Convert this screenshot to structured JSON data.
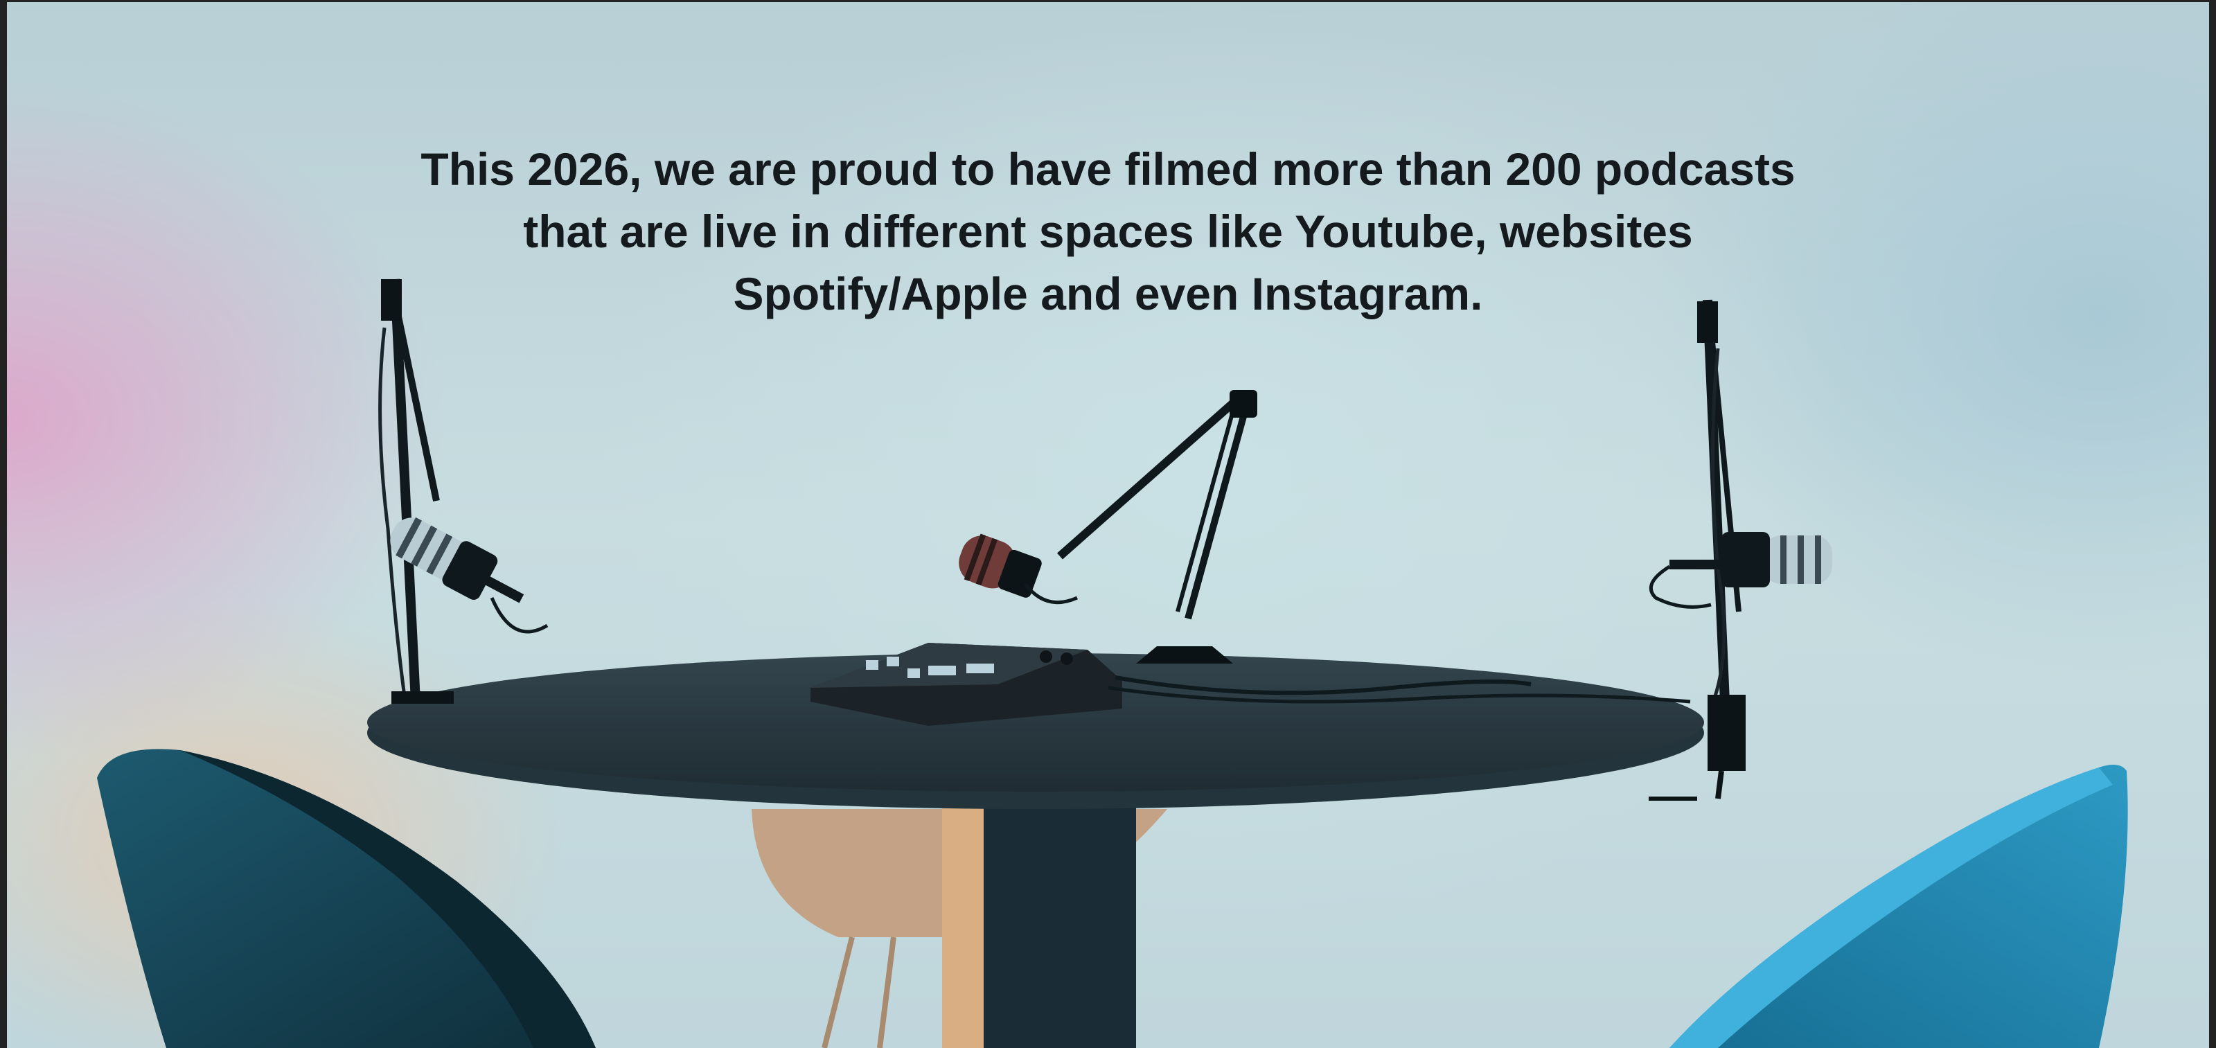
{
  "headline": {
    "lines": [
      "This 2026, we are proud to have filmed more than 200 podcasts",
      "that are live in different spaces like Youtube, websites",
      "Spotify/Apple and even Instagram."
    ]
  },
  "photo": {
    "subject": "podcast studio table with three microphones on boom arms, audio mixer and chairs",
    "colors": {
      "table": "#2b3a42",
      "chair": "#1f6f8f",
      "background": "#c8dde0",
      "text": "#141a1d"
    }
  }
}
